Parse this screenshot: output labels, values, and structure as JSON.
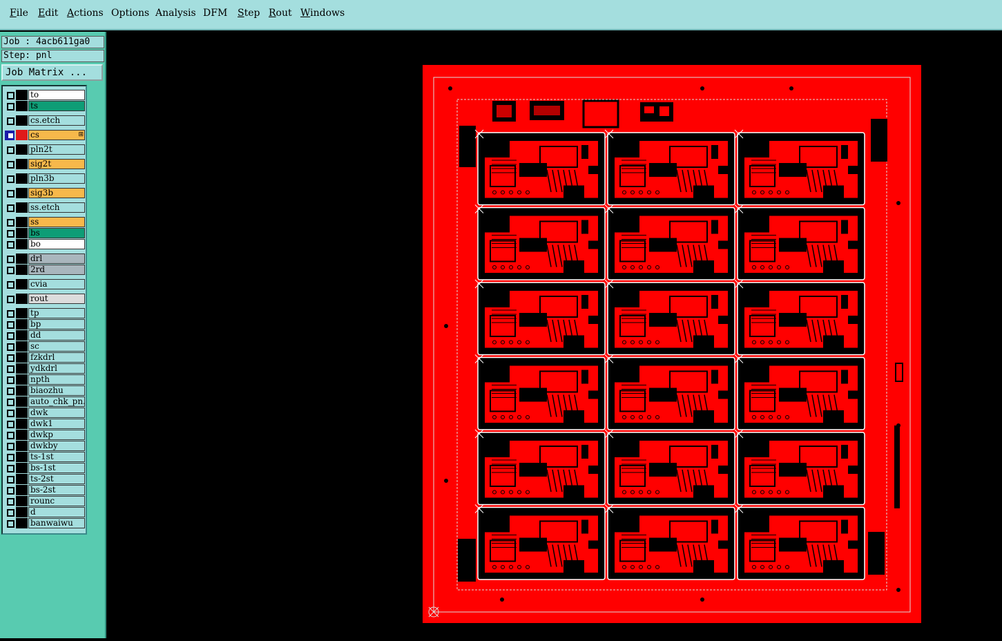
{
  "menubar": {
    "items": [
      {
        "label": "File",
        "underline": "F"
      },
      {
        "label": "Edit",
        "underline": "E"
      },
      {
        "label": "Actions",
        "underline": "A"
      },
      {
        "label": "Options",
        "underline": ""
      },
      {
        "label": "Analysis",
        "underline": ""
      },
      {
        "label": "DFM",
        "underline": ""
      },
      {
        "label": "Step",
        "underline": "S"
      },
      {
        "label": "Rout",
        "underline": "R"
      },
      {
        "label": "Windows",
        "underline": "W"
      }
    ]
  },
  "job": {
    "job_line": "Job : 4acb611ga0",
    "step_line": "Step: pnl",
    "matrix_button": "Job Matrix ..."
  },
  "layers": [
    {
      "name": "to",
      "color": "#ffffff"
    },
    {
      "name": "ts",
      "color": "#0e9d76"
    },
    {
      "name": "cs.etch",
      "color": "#a4dede"
    },
    {
      "name": "cs",
      "color": "#f7b84b",
      "active": true
    },
    {
      "name": "pln2t",
      "color": "#a4dede"
    },
    {
      "name": "sig2t",
      "color": "#f7b84b"
    },
    {
      "name": "pln3b",
      "color": "#a4dede"
    },
    {
      "name": "sig3b",
      "color": "#f7b84b"
    },
    {
      "name": "ss.etch",
      "color": "#a4dede"
    },
    {
      "name": "ss",
      "color": "#f7b84b"
    },
    {
      "name": "bs",
      "color": "#0e9d76"
    },
    {
      "name": "bo",
      "color": "#ffffff"
    },
    {
      "name": "drl",
      "color": "#a9b6bd"
    },
    {
      "name": "2rd",
      "color": "#a9b6bd"
    },
    {
      "name": "cvia",
      "color": "#a4dede"
    },
    {
      "name": "rout",
      "color": "#dcdcdc"
    },
    {
      "name": "tp",
      "color": "#a4dede"
    },
    {
      "name": "bp",
      "color": "#a4dede"
    },
    {
      "name": "dd",
      "color": "#a4dede"
    },
    {
      "name": "sc",
      "color": "#a4dede"
    },
    {
      "name": "fzkdrl",
      "color": "#a4dede"
    },
    {
      "name": "ydkdrl",
      "color": "#a4dede"
    },
    {
      "name": "npth",
      "color": "#a4dede"
    },
    {
      "name": "biaozhu",
      "color": "#a4dede"
    },
    {
      "name": "auto_chk_pn.",
      "color": "#a4dede"
    },
    {
      "name": "dwk",
      "color": "#a4dede"
    },
    {
      "name": "dwk1",
      "color": "#a4dede"
    },
    {
      "name": "dwkp",
      "color": "#a4dede"
    },
    {
      "name": "dwkby",
      "color": "#a4dede"
    },
    {
      "name": "ts-1st",
      "color": "#a4dede"
    },
    {
      "name": "bs-1st",
      "color": "#a4dede"
    },
    {
      "name": "ts-2st",
      "color": "#a4dede"
    },
    {
      "name": "bs-2st",
      "color": "#a4dede"
    },
    {
      "name": "rounc",
      "color": "#a4dede"
    },
    {
      "name": "d",
      "color": "#a4dede"
    },
    {
      "name": "banwaiwu",
      "color": "#a4dede"
    }
  ],
  "graphic": {
    "board_color": "#ff0000",
    "background_color": "#000000",
    "panel_grid": {
      "columns": 3,
      "rows": 6
    }
  }
}
